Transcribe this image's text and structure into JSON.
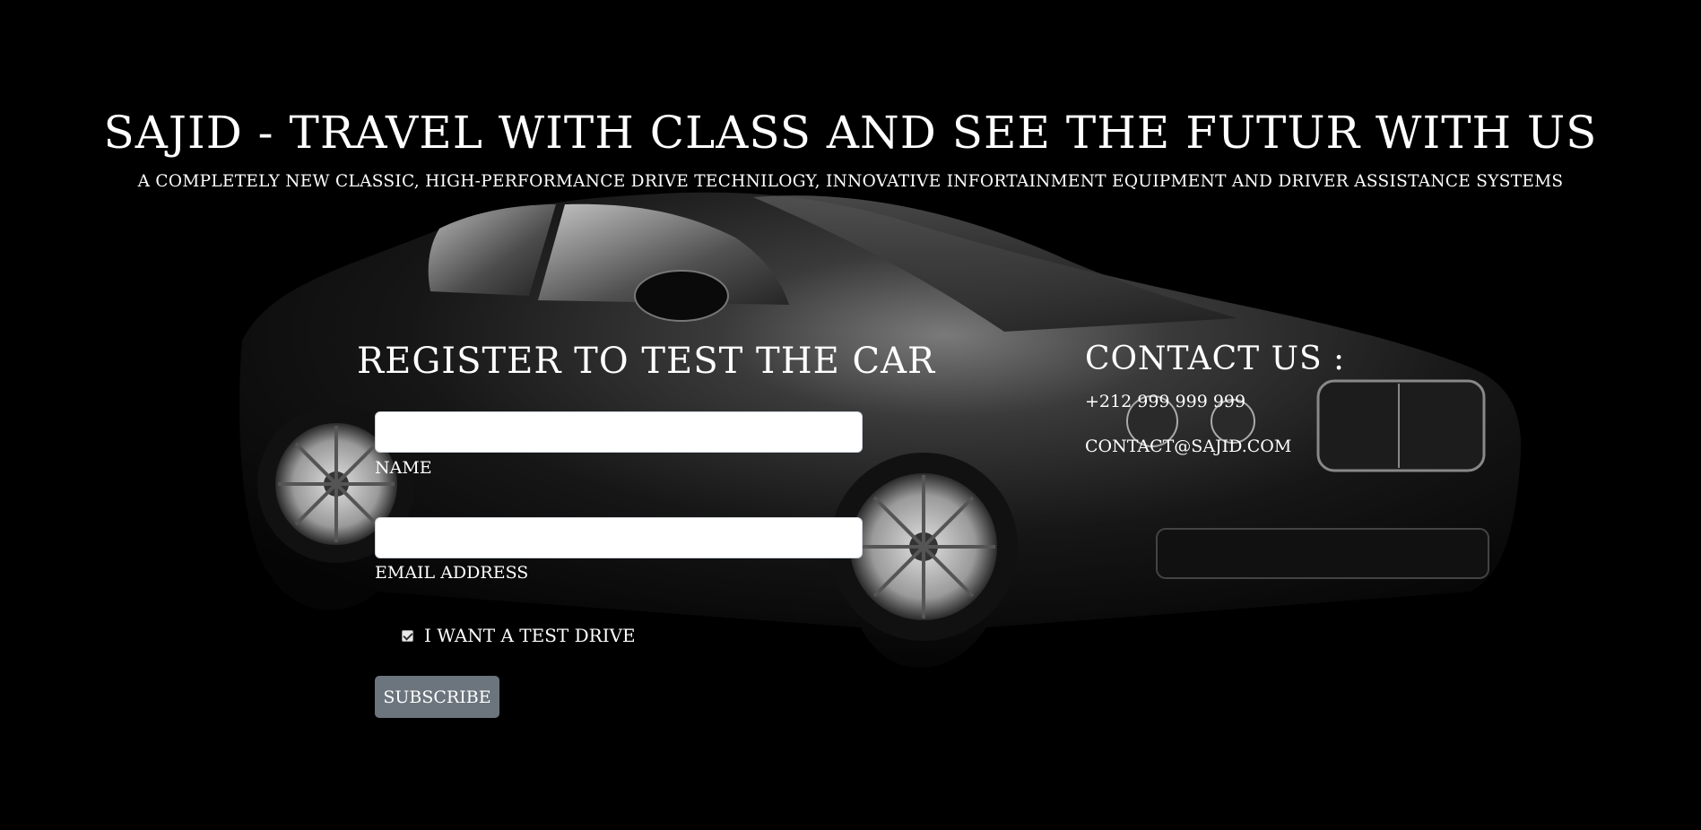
{
  "hero": {
    "title": "SAJID - TRAVEL WITH CLASS AND SEE THE FUTUR WITH US",
    "subtitle": "A COMPLETELY NEW CLASSIC, HIGH-PERFORMANCE DRIVE TECHNILOGY, INNOVATIVE INFORTAINMENT EQUIPMENT AND DRIVER ASSISTANCE SYSTEMS"
  },
  "register": {
    "title": "REGISTER TO TEST THE CAR",
    "name_label": "NAME",
    "name_value": "",
    "email_label": "EMAIL ADDRESS",
    "email_value": "",
    "checkbox_label": "I WANT A TEST DRIVE",
    "checkbox_checked": true,
    "submit_label": "SUBSCRIBE"
  },
  "contact": {
    "title": "CONTACT US :",
    "phone": "+212 999 999 999",
    "email": "CONTACT@SAJID.COM"
  },
  "colors": {
    "background": "#000000",
    "text": "#ffffff",
    "button": "#6c757d"
  },
  "icons": {
    "background_image": "black-luxury-car"
  }
}
